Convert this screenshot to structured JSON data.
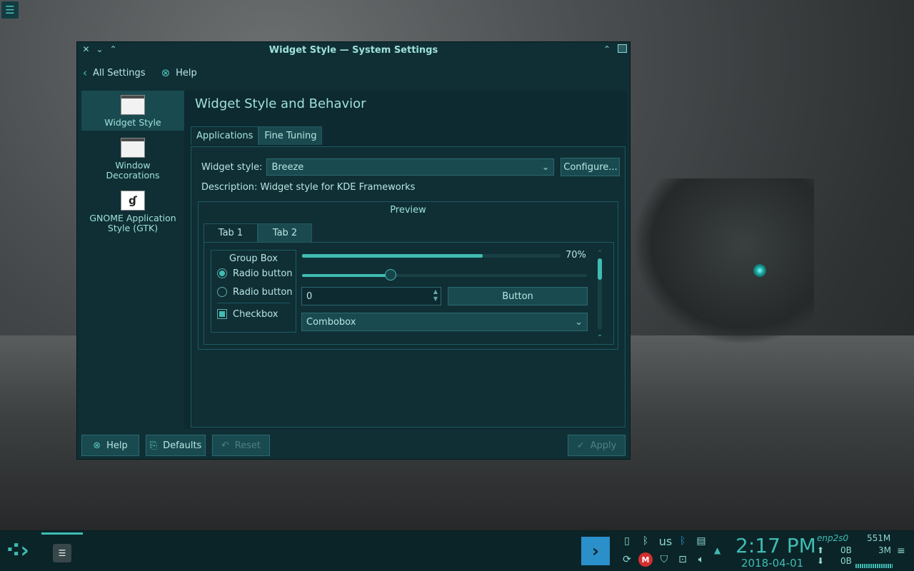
{
  "desktop": {
    "menu_icon": "hamburger-icon"
  },
  "window": {
    "title": "Widget Style — System Settings",
    "nav": {
      "back_label": "All Settings",
      "help_label": "Help"
    },
    "sidebar": [
      {
        "label": "Widget Style",
        "active": true
      },
      {
        "label": "Window Decorations",
        "active": false
      },
      {
        "label": "GNOME Application Style (GTK)",
        "active": false
      }
    ],
    "page_title": "Widget Style and Behavior",
    "tabs": [
      {
        "label": "Applications",
        "active": true
      },
      {
        "label": "Fine Tuning",
        "active": false
      }
    ],
    "widget_style_label": "Widget style:",
    "widget_style_value": "Breeze",
    "configure_label": "Configure...",
    "description": "Description: Widget style for KDE Frameworks",
    "preview": {
      "title": "Preview",
      "tabs": [
        {
          "label": "Tab 1",
          "active": true
        },
        {
          "label": "Tab 2",
          "active": false
        }
      ],
      "group_box_title": "Group Box",
      "radio1": "Radio button",
      "radio2": "Radio button",
      "checkbox": "Checkbox",
      "progress_percent": 70,
      "progress_label": "70%",
      "slider_value": 0.31,
      "spin_value": "0",
      "button_label": "Button",
      "combobox_value": "Combobox"
    },
    "buttons": {
      "help": "Help",
      "defaults": "Defaults",
      "reset": "Reset",
      "apply": "Apply"
    }
  },
  "taskbar": {
    "keyboard_layout": "us",
    "time": "2:17 PM",
    "date": "2018-04-01",
    "net_interface": "enp2s0",
    "net_up": "0B",
    "net_down": "0B",
    "mem_used": "551M",
    "mem_other": "3M",
    "accent": "#3fbcb3"
  }
}
